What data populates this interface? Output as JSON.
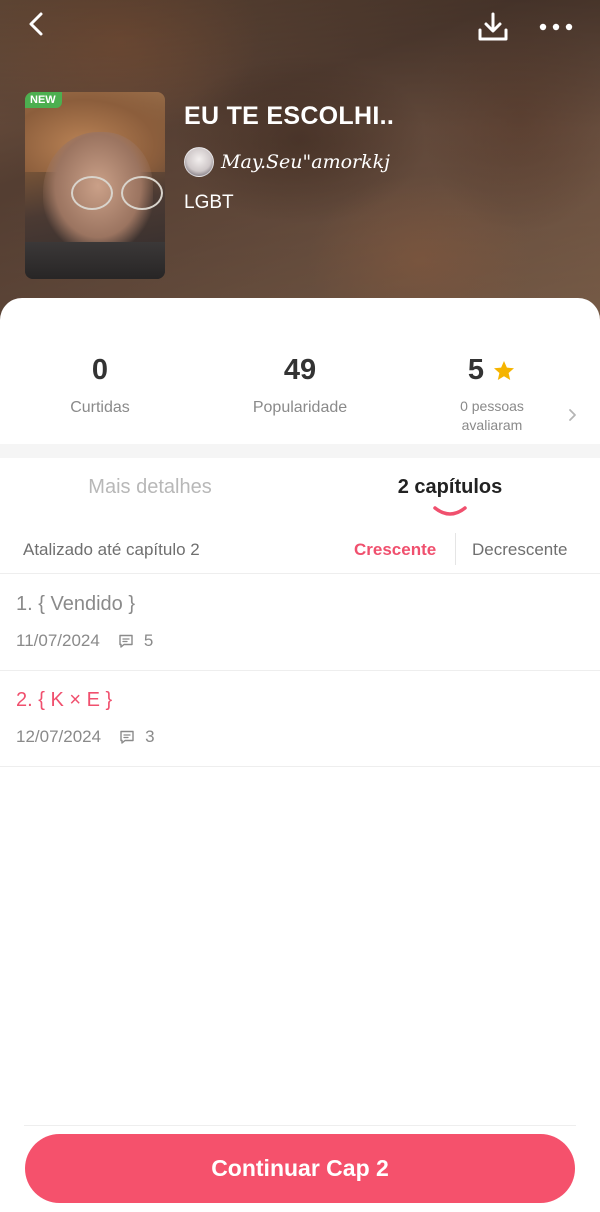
{
  "header": {
    "back_icon": "chevron-left-icon",
    "download_icon": "download-icon",
    "more_icon": "more-horizontal-icon"
  },
  "story": {
    "badge": "NEW",
    "title": "EU TE ESCOLHI..",
    "author": "May.Seu\"amorkkj",
    "genre": "LGBT"
  },
  "stats": {
    "likes": {
      "value": "0",
      "label": "Curtidas"
    },
    "popularity": {
      "value": "49",
      "label": "Popularidade"
    },
    "rating": {
      "value": "5",
      "label_line1": "0 pessoas",
      "label_line2": "avaliaram",
      "icon": "star-icon",
      "icon_color": "#f5b400"
    }
  },
  "tabs": {
    "details": "Mais detalhes",
    "chapters": "2 capítulos"
  },
  "sort": {
    "updated": "Atalizado até capítulo 2",
    "ascending": "Crescente",
    "descending": "Decrescente"
  },
  "chapters": [
    {
      "title": "1. { Vendido }",
      "date": "11/07/2024",
      "comments": "5"
    },
    {
      "title": "2. { K × E }",
      "date": "12/07/2024",
      "comments": "3"
    }
  ],
  "cta": {
    "label": "Continuar Cap 2"
  },
  "colors": {
    "accent": "#f0506e",
    "button": "#f5516c",
    "badge": "#4caf50"
  }
}
